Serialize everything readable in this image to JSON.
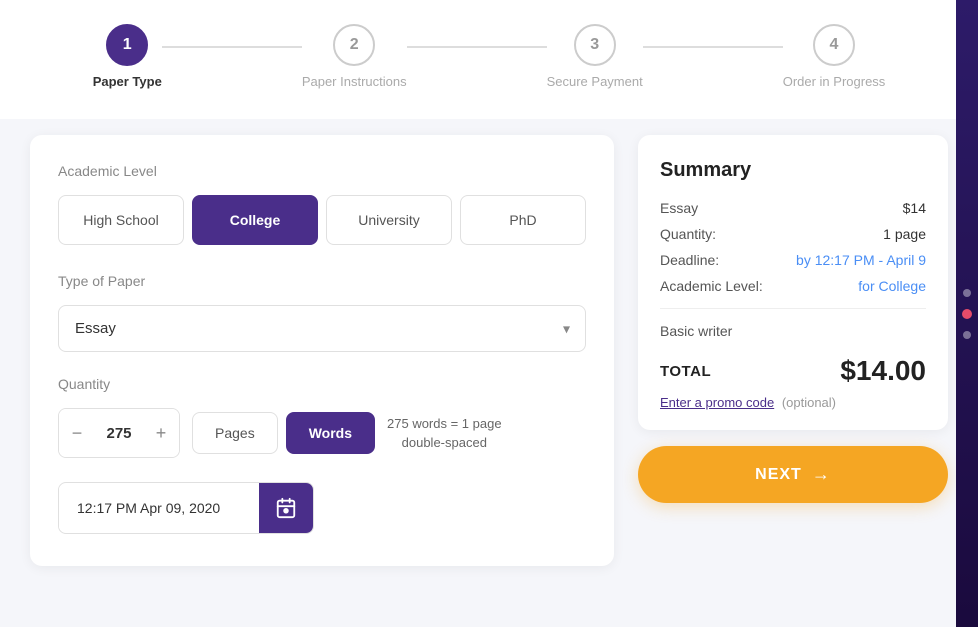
{
  "stepper": {
    "steps": [
      {
        "number": "1",
        "label": "Paper Type",
        "active": true
      },
      {
        "number": "2",
        "label": "Paper Instructions",
        "active": false
      },
      {
        "number": "3",
        "label": "Secure Payment",
        "active": false
      },
      {
        "number": "4",
        "label": "Order in Progress",
        "active": false
      }
    ]
  },
  "form": {
    "academic_level_label": "Academic Level",
    "academic_levels": [
      {
        "id": "high-school",
        "label": "High School",
        "active": false
      },
      {
        "id": "college",
        "label": "College",
        "active": true
      },
      {
        "id": "university",
        "label": "University",
        "active": false
      },
      {
        "id": "phd",
        "label": "PhD",
        "active": false
      }
    ],
    "type_of_paper_label": "Type of Paper",
    "type_of_paper_value": "Essay",
    "quantity_label": "Quantity",
    "quantity_value": "275",
    "unit_pages": "Pages",
    "unit_words": "Words",
    "qty_note_line1": "275 words = 1 page",
    "qty_note_line2": "double-spaced",
    "deadline_value": "12:17 PM Apr 09, 2020"
  },
  "summary": {
    "title": "Summary",
    "rows": [
      {
        "key": "Essay",
        "value": "$14",
        "blue": false
      },
      {
        "key": "Quantity:",
        "value": "1 page",
        "blue": false
      },
      {
        "key": "Deadline:",
        "value": "by 12:17 PM - April 9",
        "blue": true
      },
      {
        "key": "Academic Level:",
        "value": "for College",
        "blue": true
      }
    ],
    "writer_label": "Basic writer",
    "total_label": "TOTAL",
    "total_amount": "$14.00",
    "promo_link": "Enter a promo code",
    "promo_optional": "(optional)"
  },
  "next_button": {
    "label": "NEXT"
  }
}
